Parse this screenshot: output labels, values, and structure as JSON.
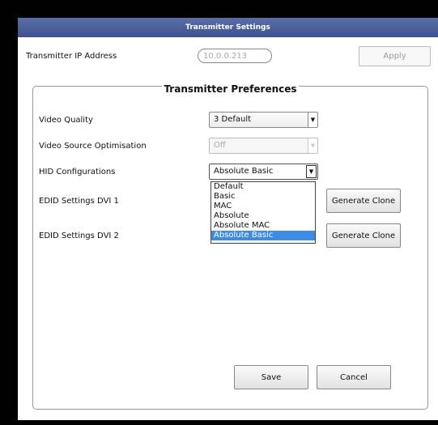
{
  "window": {
    "title": "Transmitter Settings"
  },
  "transmitter": {
    "ip_label": "Transmitter IP Address",
    "ip_value": "10.0.0.213",
    "apply_label": "Apply"
  },
  "preferences": {
    "title": "Transmitter Preferences",
    "rows": [
      {
        "label": "Video Quality",
        "value": "3 Default"
      },
      {
        "label": "Video Source Optimisation",
        "value": "Off"
      },
      {
        "label": "HID Configurations",
        "value": "Absolute Basic"
      },
      {
        "label": "EDID Settings  DVI 1"
      },
      {
        "label": "EDID Settings  DVI 2"
      }
    ],
    "hid_options": [
      "Default",
      "Basic",
      "MAC",
      "Absolute",
      "Absolute MAC",
      "Absolute Basic"
    ],
    "generate_clone_label": "Generate Clone",
    "save_label": "Save",
    "cancel_label": "Cancel"
  },
  "colors": {
    "title_bar": "#4a5e9e",
    "selected_option": "#3c8be5"
  }
}
